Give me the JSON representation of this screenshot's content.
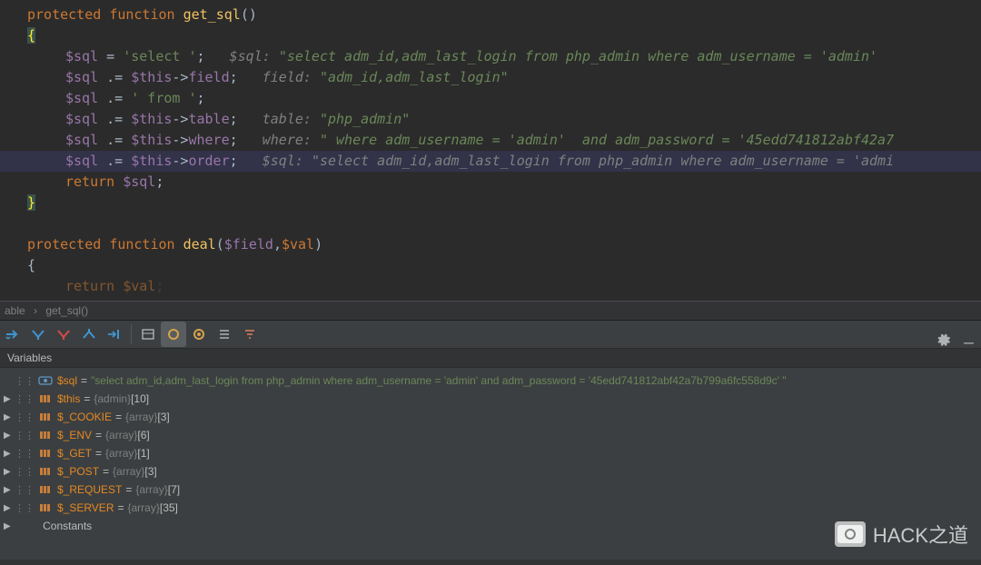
{
  "code": {
    "fn1_sig_kw1": "protected ",
    "fn1_sig_kw2": "function ",
    "fn1_name": "get_sql",
    "fn1_parens": "()",
    "brace_open": "{",
    "brace_close": "}",
    "l1_var": "$sql",
    "l1_op": " = ",
    "l1_str": "'select '",
    "l1_semi": ";",
    "l1_hint_label": "$sql: ",
    "l1_hint_str": "\"select adm_id,adm_last_login from php_admin where adm_username = 'admin'  ",
    "l2_var": "$sql",
    "l2_op": " .= ",
    "l2_this": "$this",
    "l2_arrow": "->",
    "l2_field": "field",
    "l2_semi": ";",
    "l2_hint_label": "field: ",
    "l2_hint_str": "\"adm_id,adm_last_login\"",
    "l3_var": "$sql",
    "l3_op": " .= ",
    "l3_str": "' from '",
    "l3_semi": ";",
    "l4_var": "$sql",
    "l4_op": " .= ",
    "l4_this": "$this",
    "l4_arrow": "->",
    "l4_field": "table",
    "l4_semi": ";",
    "l4_hint_label": "table: ",
    "l4_hint_str": "\"php_admin\"",
    "l5_var": "$sql",
    "l5_op": " .= ",
    "l5_this": "$this",
    "l5_arrow": "->",
    "l5_field": "where",
    "l5_semi": ";",
    "l5_hint_label": "where: ",
    "l5_hint_str": "\" where adm_username = 'admin'  and adm_password = '45edd741812abf42a7",
    "l6_var": "$sql",
    "l6_op": " .= ",
    "l6_this": "$this",
    "l6_arrow": "->",
    "l6_field": "order",
    "l6_semi": ";",
    "l6_hint_label": "$sql: ",
    "l6_hint_str": "\"select adm_id,adm_last_login from php_admin where adm_username = 'admi",
    "l7_kw": "return ",
    "l7_var": "$sql",
    "l7_semi": ";",
    "fn2_sig_kw1": "protected ",
    "fn2_sig_kw2": "function ",
    "fn2_name": "deal",
    "fn2_p_open": "(",
    "fn2_p1": "$field",
    "fn2_comma": ",",
    "fn2_p2": "$val",
    "fn2_p_close": ")",
    "fn2_ret_kw": "return ",
    "fn2_ret_val": "$val",
    "fn2_ret_semi": ";"
  },
  "breadcrumb": {
    "item1": "able",
    "sep": "›",
    "item2": "get_sql()"
  },
  "debug": {
    "vars_header": "Variables",
    "rows": {
      "r0_name": "$sql",
      "r0_eq": " = ",
      "r0_val": "\"select adm_id,adm_last_login from php_admin where adm_username = 'admin'  and adm_password = '45edd741812abf42a7b799a6fc558d9c' \"",
      "r1_name": "$this",
      "r1_eq": " = ",
      "r1_type": "{admin}",
      "r1_count": " [10]",
      "r2_name": "$_COOKIE",
      "r2_eq": " = ",
      "r2_type": "{array}",
      "r2_count": " [3]",
      "r3_name": "$_ENV",
      "r3_eq": " = ",
      "r3_type": "{array}",
      "r3_count": " [6]",
      "r4_name": "$_GET",
      "r4_eq": " = ",
      "r4_type": "{array}",
      "r4_count": " [1]",
      "r5_name": "$_POST",
      "r5_eq": " = ",
      "r5_type": "{array}",
      "r5_count": " [3]",
      "r6_name": "$_REQUEST",
      "r6_eq": " = ",
      "r6_type": "{array}",
      "r6_count": " [7]",
      "r7_name": "$_SERVER",
      "r7_eq": " = ",
      "r7_type": "{array}",
      "r7_count": " [35]",
      "r8_name": "Constants"
    }
  },
  "watermark": "HACK之道"
}
